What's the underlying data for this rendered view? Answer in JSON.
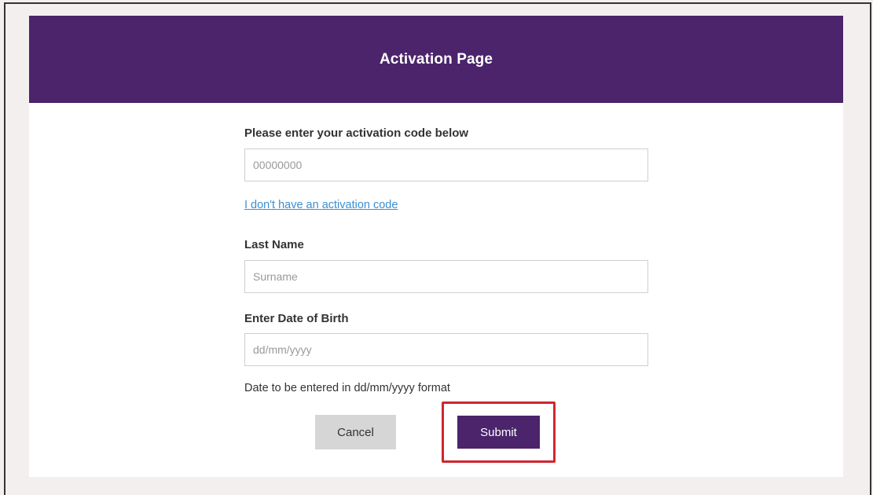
{
  "header": {
    "title": "Activation Page"
  },
  "form": {
    "activation_label": "Please enter your activation code below",
    "activation_placeholder": "00000000",
    "no_code_link": "I don't have an activation code",
    "last_name_label": "Last Name",
    "last_name_placeholder": "Surname",
    "dob_label": "Enter Date of Birth",
    "dob_placeholder": "dd/mm/yyyy",
    "dob_hint": "Date to be entered in dd/mm/yyyy format"
  },
  "buttons": {
    "cancel_label": "Cancel",
    "submit_label": "Submit"
  },
  "colors": {
    "brand": "#4b246c",
    "link": "#3d8fd1",
    "highlight": "#d0262f",
    "cancel_bg": "#d6d6d6"
  }
}
